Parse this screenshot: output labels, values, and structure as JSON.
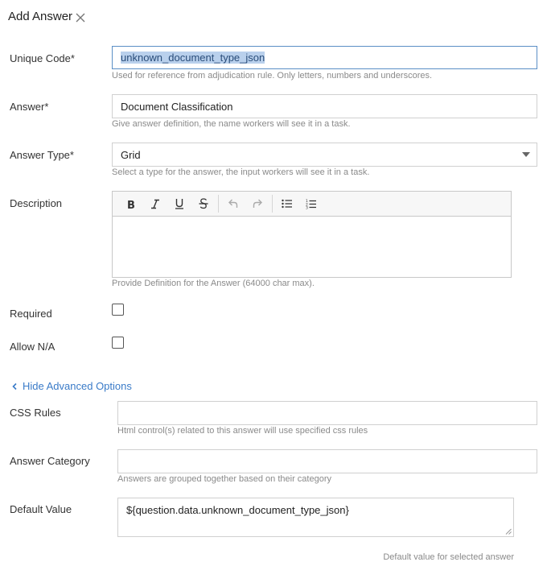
{
  "dialog": {
    "title": "Add Answer",
    "close_icon": "close-icon"
  },
  "fields": {
    "unique_code": {
      "label": "Unique Code*",
      "value": "unknown_document_type_json",
      "hint": "Used for reference from adjudication rule. Only letters, numbers and underscores."
    },
    "answer": {
      "label": "Answer*",
      "value": "Document Classification",
      "hint": "Give answer definition, the name workers will see it in a task."
    },
    "answer_type": {
      "label": "Answer Type*",
      "value": "Grid",
      "hint": "Select a type for the answer, the input workers will see it in a task."
    },
    "description": {
      "label": "Description",
      "value": "",
      "hint": "Provide Definition for the Answer (64000 char max).",
      "toolbar": [
        "bold-icon",
        "italic-icon",
        "underline-icon",
        "strikethrough-icon",
        "undo-icon",
        "redo-icon",
        "bullet-list-icon",
        "numbered-list-icon"
      ]
    },
    "required": {
      "label": "Required",
      "checked": false
    },
    "allow_na": {
      "label": "Allow N/A",
      "checked": false
    }
  },
  "advanced": {
    "toggle_label": "Hide Advanced Options",
    "css_rules": {
      "label": "CSS Rules",
      "value": "",
      "hint": "Html control(s) related to this answer will use specified css rules"
    },
    "answer_category": {
      "label": "Answer Category",
      "value": "",
      "hint": "Answers are grouped together based on their category"
    },
    "default_value": {
      "label": "Default Value",
      "value": "${question.data.unknown_document_type_json}",
      "hint": "Default value for selected answer"
    }
  },
  "colors": {
    "accent": "#3a7bc8",
    "selection": "#b9d0ec",
    "focus_border": "#5b8fc6"
  }
}
